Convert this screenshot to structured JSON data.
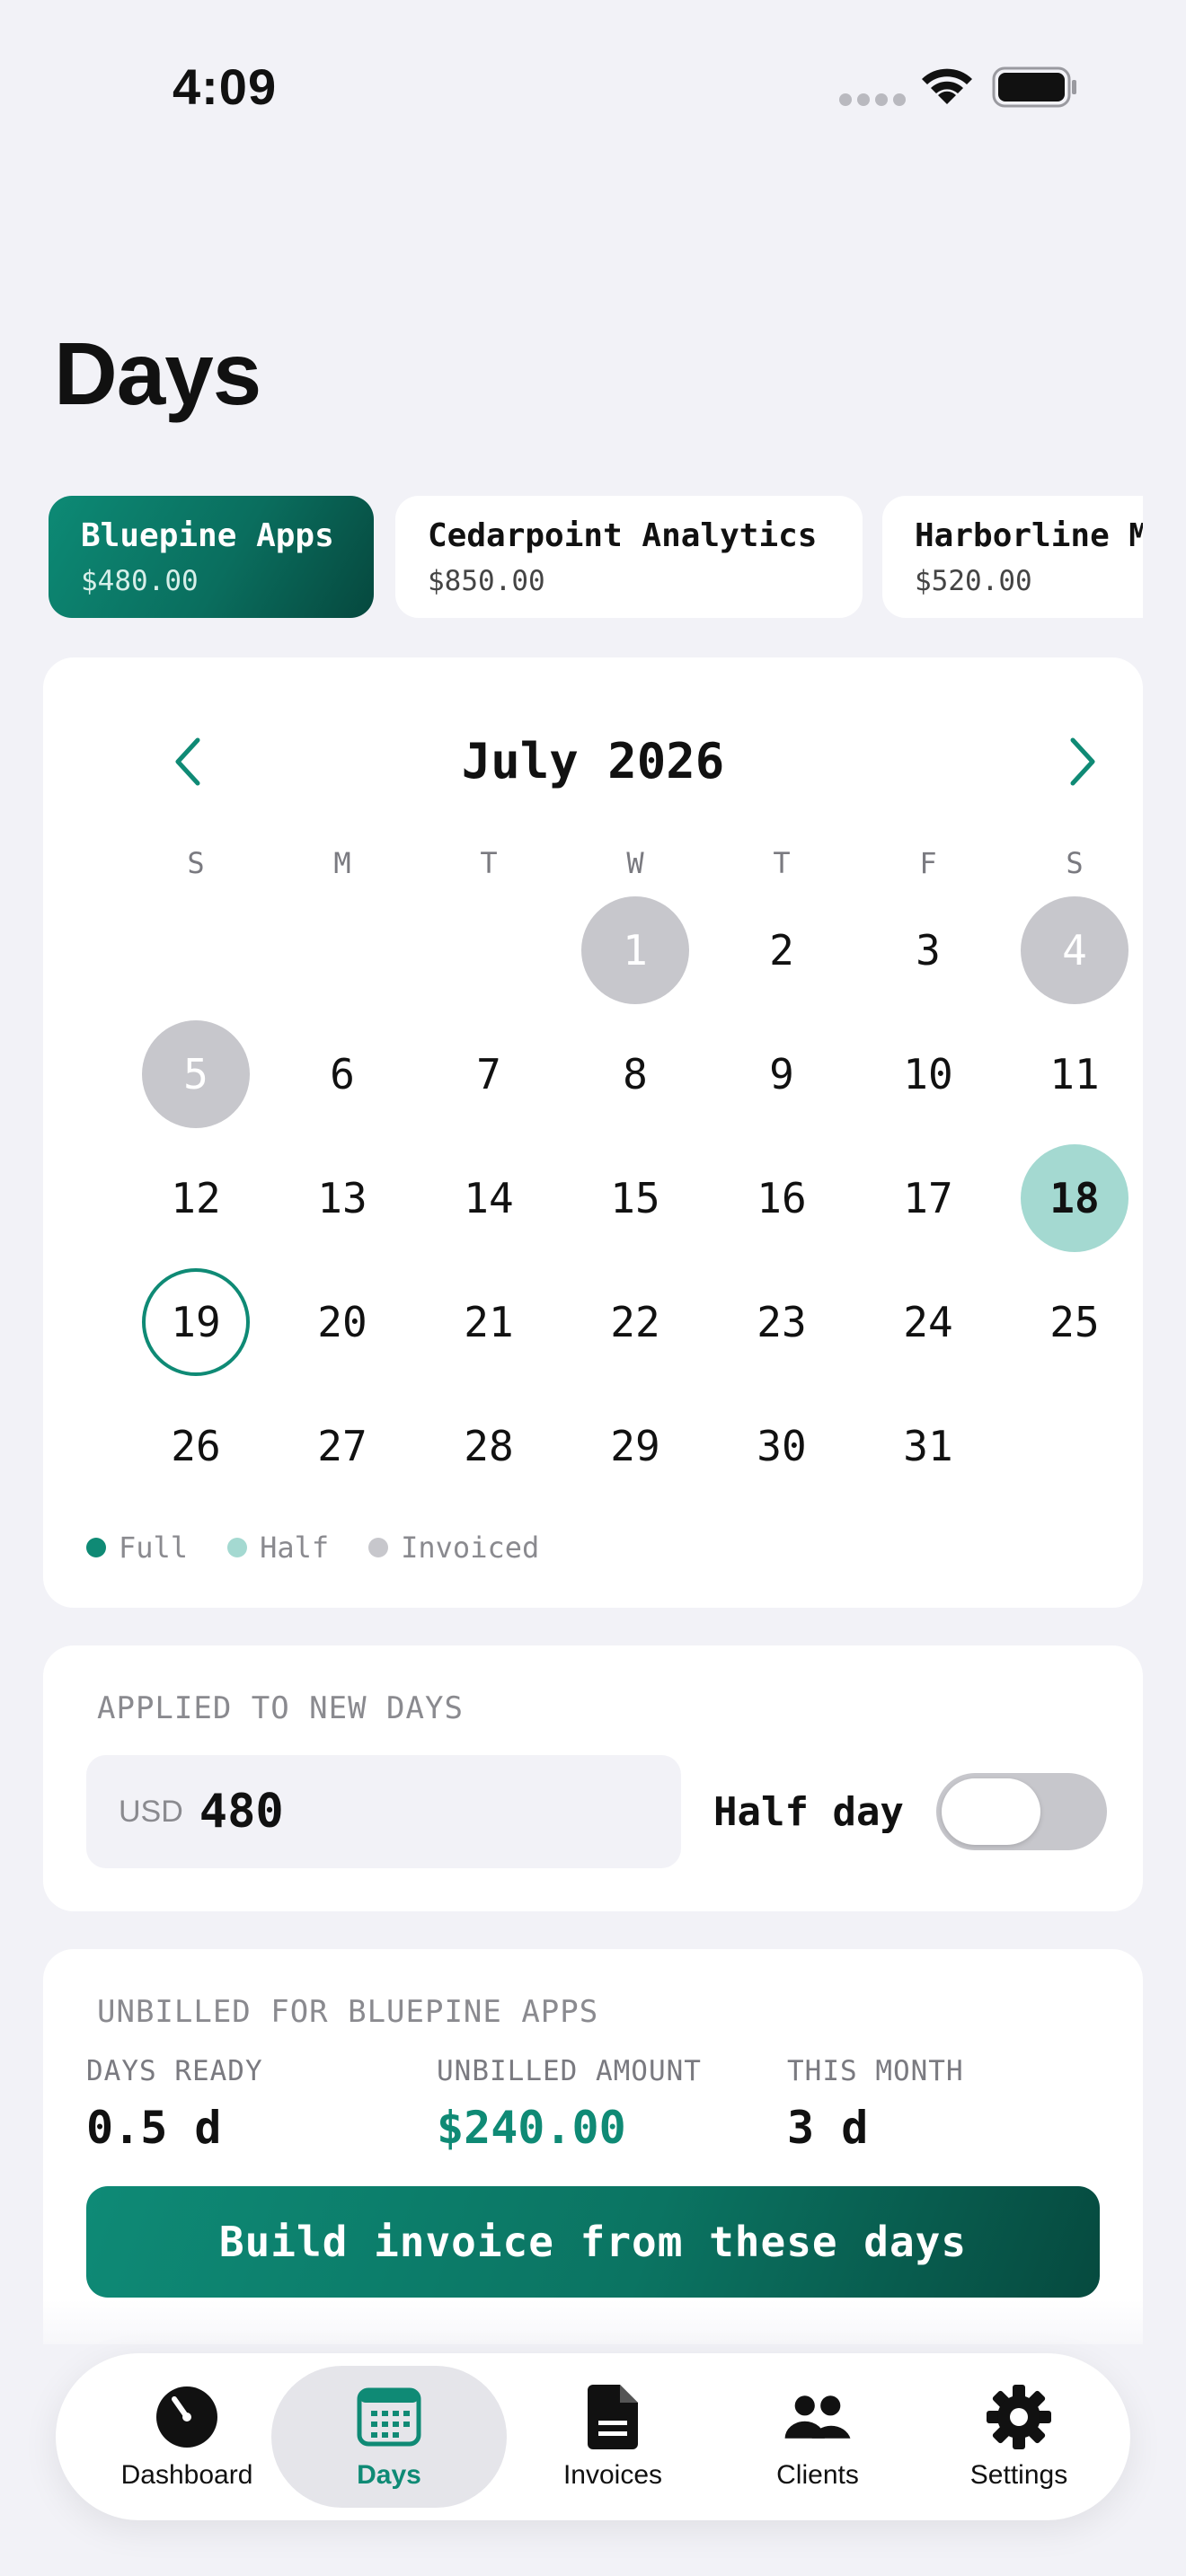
{
  "status_bar": {
    "time": "4:09"
  },
  "page": {
    "title": "Days"
  },
  "clients": [
    {
      "name": "Bluepine Apps",
      "amount": "$480.00",
      "active": true
    },
    {
      "name": "Cedarpoint Analytics",
      "amount": "$850.00",
      "active": false
    },
    {
      "name": "Harborline Mobile",
      "amount": "$520.00",
      "active": false
    }
  ],
  "calendar": {
    "month_title": "July 2026",
    "weekdays": [
      "S",
      "M",
      "T",
      "W",
      "T",
      "F",
      "S"
    ],
    "first_weekday_index": 3,
    "days_in_month": 31,
    "invoiced_days": [
      1,
      4,
      5
    ],
    "half_days": [
      18
    ],
    "full_days": [],
    "today": 19,
    "legend": [
      {
        "label": "Full",
        "color": "#0f8a75"
      },
      {
        "label": "Half",
        "color": "#a4d9d1"
      },
      {
        "label": "Invoiced",
        "color": "#c7c7cc"
      }
    ]
  },
  "rate_settings": {
    "section_label": "APPLIED TO NEW DAYS",
    "currency": "USD",
    "rate": "480",
    "half_day_label": "Half day",
    "half_day_on": false
  },
  "unbilled": {
    "section_label": "UNBILLED FOR BLUEPINE APPS",
    "stats": [
      {
        "label": "DAYS READY",
        "value": "0.5 d"
      },
      {
        "label": "UNBILLED AMOUNT",
        "value": "$240.00"
      },
      {
        "label": "THIS MONTH",
        "value": "3 d"
      }
    ],
    "button_label": "Build invoice from these days"
  },
  "tab_bar": {
    "active": "days",
    "tabs": [
      {
        "id": "dashboard",
        "label": "Dashboard",
        "icon": "gauge-icon"
      },
      {
        "id": "days",
        "label": "Days",
        "icon": "calendar-icon"
      },
      {
        "id": "invoices",
        "label": "Invoices",
        "icon": "document-icon"
      },
      {
        "id": "clients",
        "label": "Clients",
        "icon": "people-icon"
      },
      {
        "id": "settings",
        "label": "Settings",
        "icon": "gear-icon"
      }
    ]
  },
  "colors": {
    "accent": "#0f8a75",
    "accent_dark": "#064a3f",
    "half": "#a4d9d1",
    "invoiced": "#c7c7cc",
    "background": "#f2f2f7"
  }
}
